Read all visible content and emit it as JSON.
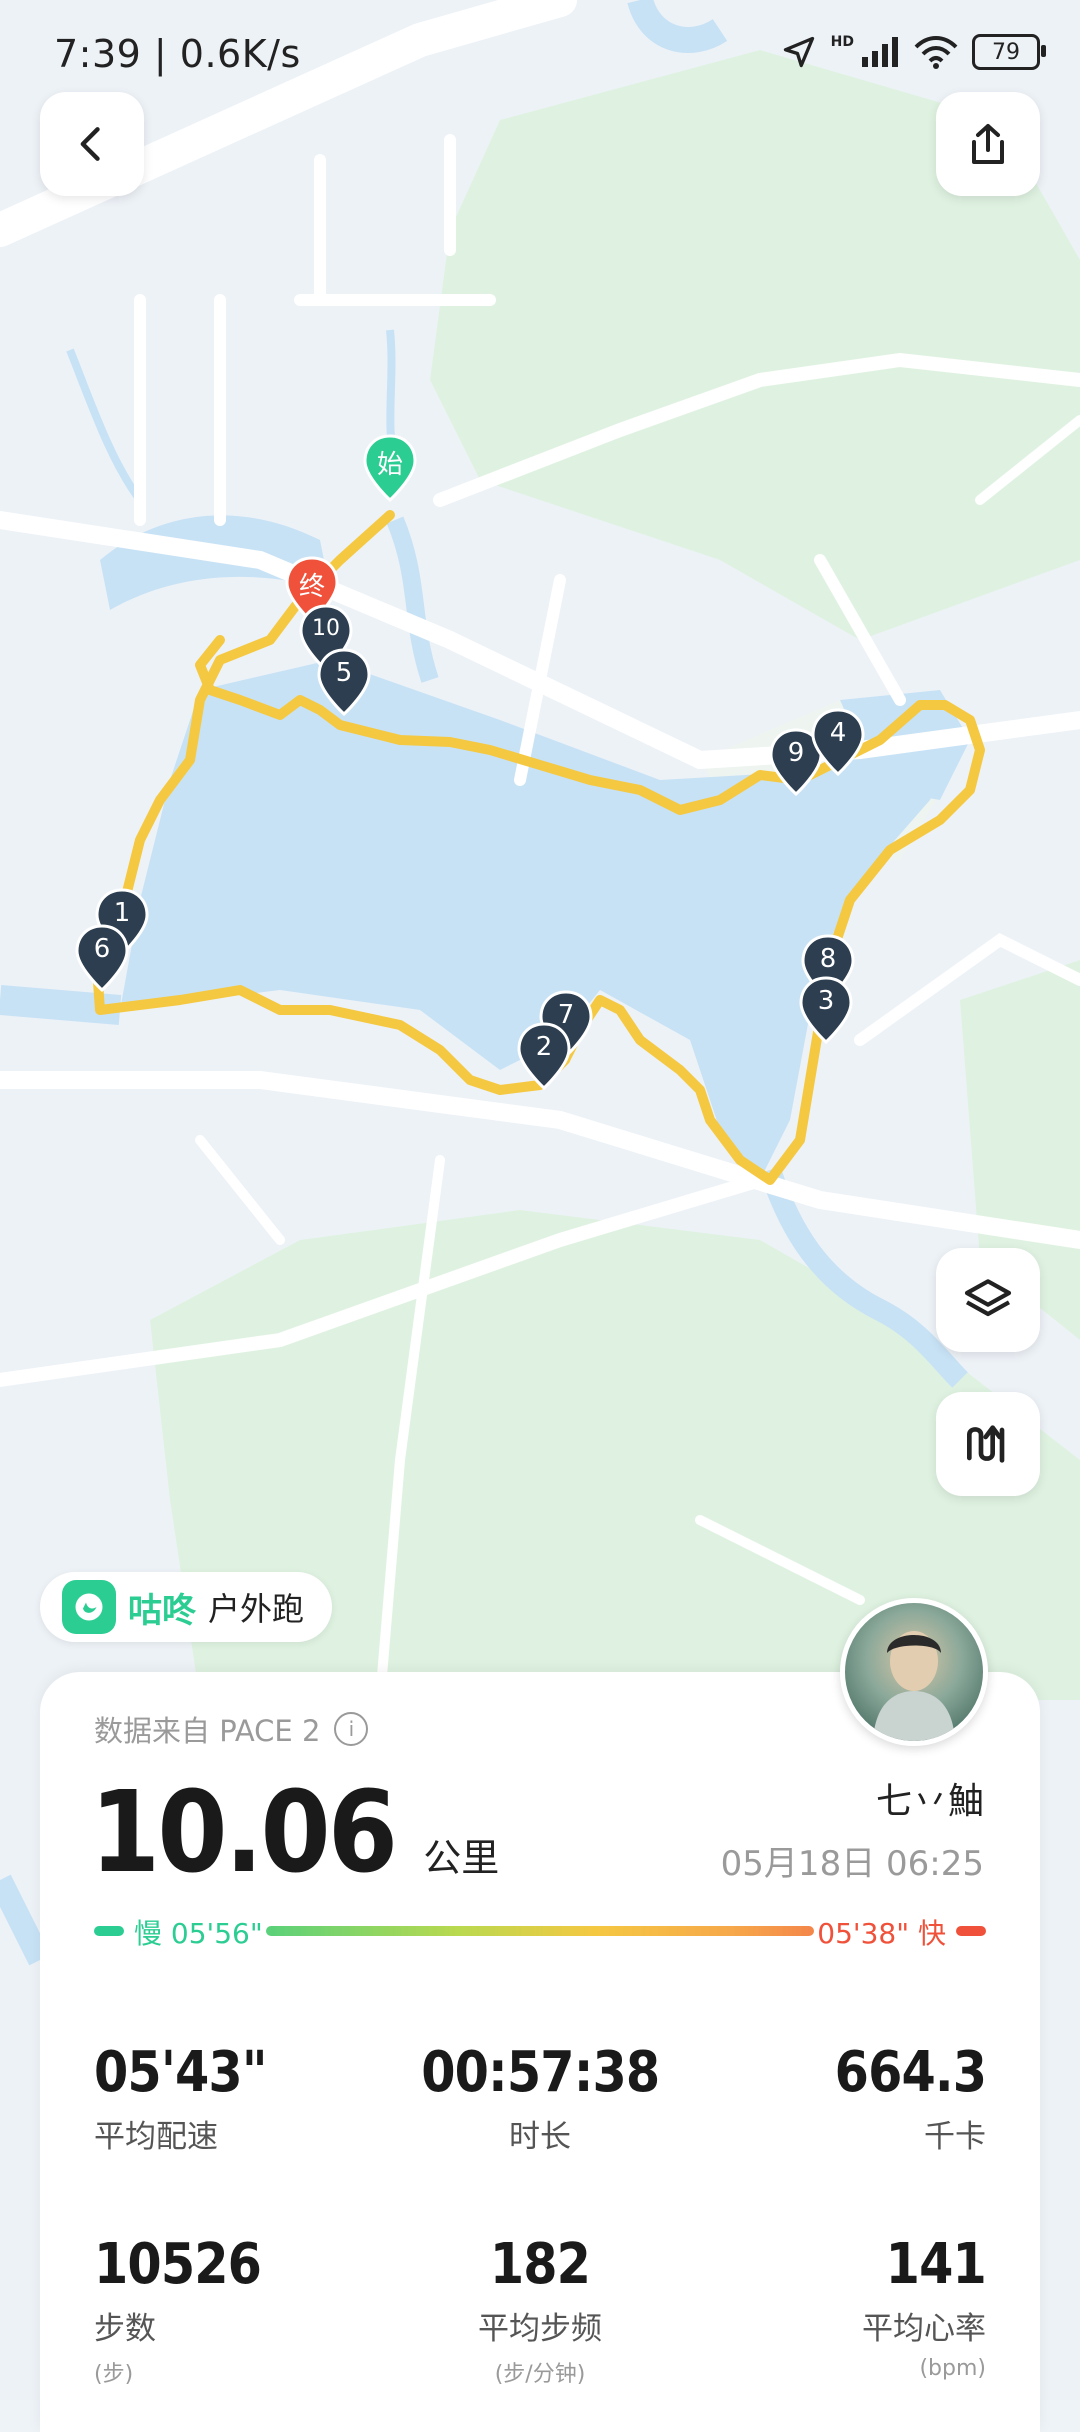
{
  "status_bar": {
    "time_speed": "7:39 | 0.6K/s",
    "hd_label": "HD",
    "battery": "79"
  },
  "map": {
    "start_label": "始",
    "end_label": "终",
    "route_color": "#f5c842",
    "water_color": "#c8e2f5",
    "green_color": "#dff2e1",
    "kilometer_markers": [
      "1",
      "2",
      "3",
      "4",
      "5",
      "6",
      "7",
      "8",
      "9",
      "10"
    ]
  },
  "app": {
    "name": "咕咚",
    "activity": "户外跑"
  },
  "card": {
    "source_text": "数据来自 PACE 2",
    "info_icon_glyph": "i",
    "distance_value": "10.06",
    "distance_unit": "公里",
    "user_name": "七丷鮋",
    "date_time": "05月18日 06:25",
    "pace_slow": "慢 05'56\"",
    "pace_fast": "05'38\" 快",
    "stats": [
      {
        "value": "05'43\"",
        "label": "平均配速",
        "sub": ""
      },
      {
        "value": "00:57:38",
        "label": "时长",
        "sub": ""
      },
      {
        "value": "664.3",
        "label": "千卡",
        "sub": ""
      },
      {
        "value": "10526",
        "label": "步数",
        "sub": "(步)"
      },
      {
        "value": "182",
        "label": "平均步频",
        "sub": "(步/分钟)"
      },
      {
        "value": "141",
        "label": "平均心率",
        "sub": "(bpm)"
      }
    ]
  },
  "colors": {
    "accent_green": "#2ccd93",
    "fast_red": "#f0513a",
    "marker_dark": "#2c3e50"
  }
}
